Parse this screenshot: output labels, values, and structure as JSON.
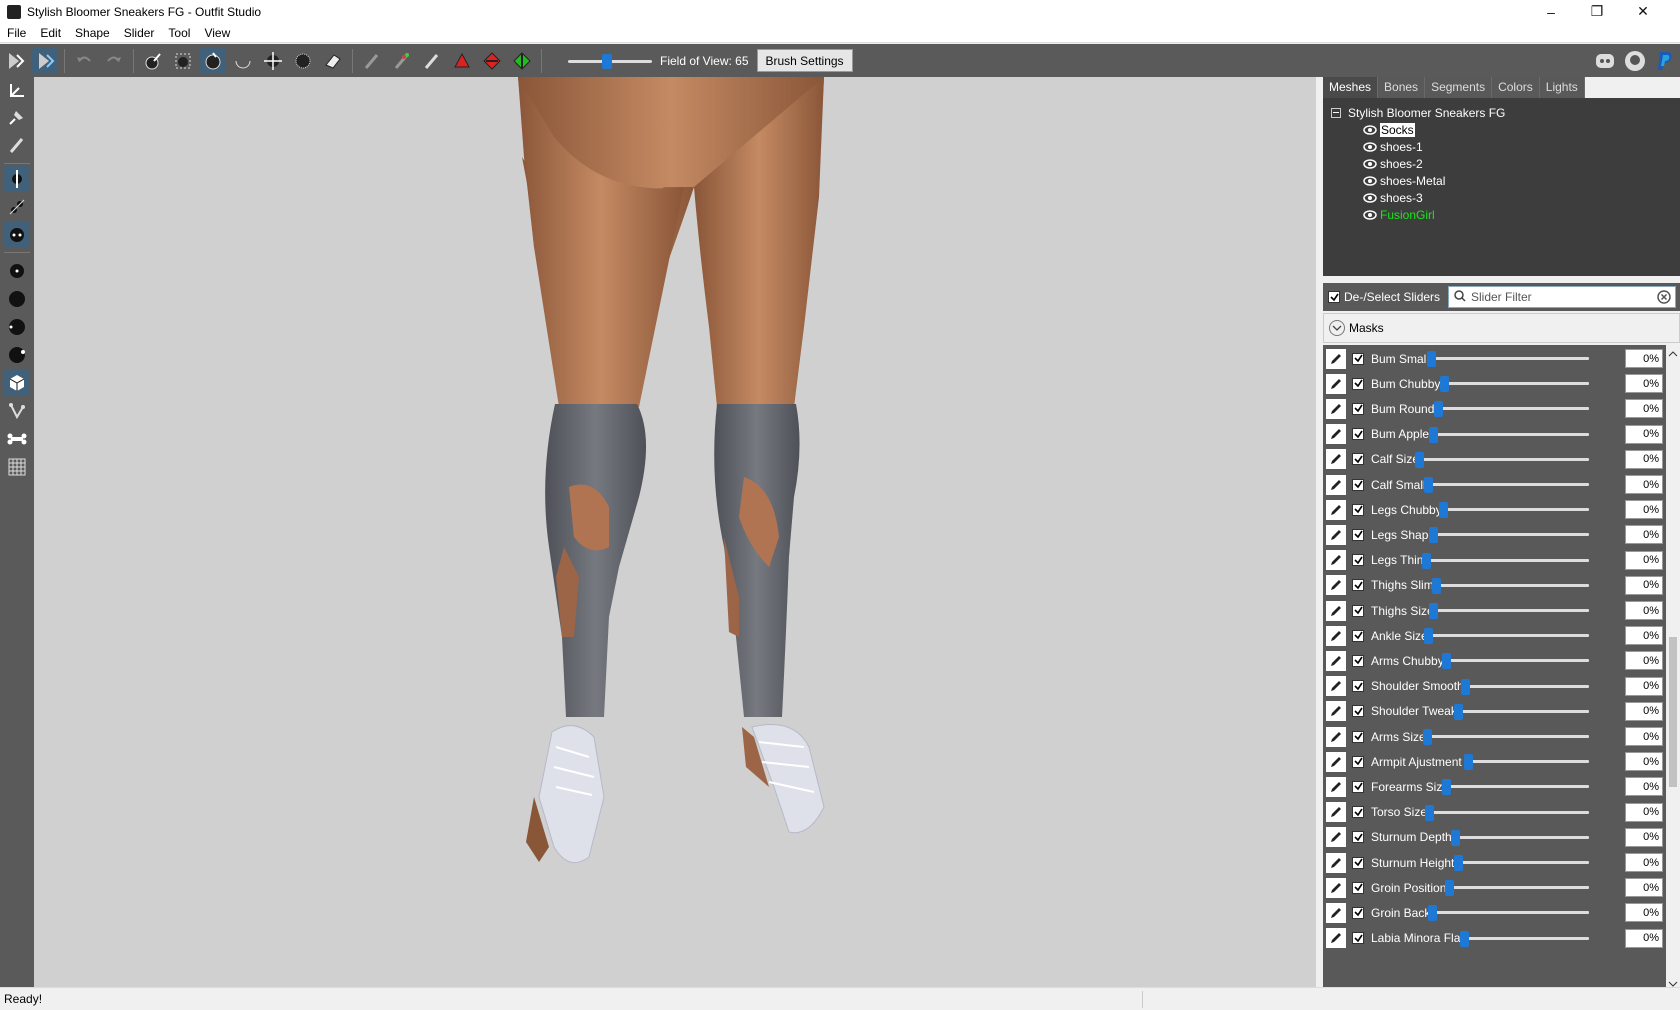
{
  "window": {
    "title": "Stylish Bloomer Sneakers FG - Outfit Studio"
  },
  "menu": [
    "File",
    "Edit",
    "Shape",
    "Slider",
    "Tool",
    "View"
  ],
  "toolbar": {
    "fov_label": "Field of View: 65",
    "fov_value": 65,
    "brush_settings_label": "Brush Settings",
    "left_icons": [
      "outfit-studio-icon",
      "slider-edit-icon",
      "undo-icon",
      "redo-icon",
      "select-icon",
      "mask-select-icon",
      "inflate-brush-icon",
      "deflate-brush-icon",
      "move-brush-icon",
      "smooth-brush-icon",
      "eraser-icon",
      "weight-brush-icon",
      "color-brush-icon",
      "alpha-brush-icon",
      "vertex-brush-icon",
      "collapse-vertex-icon",
      "flip-edge-icon"
    ],
    "right_icons": [
      "discord-icon",
      "github-icon",
      "paypal-icon"
    ]
  },
  "left_tools": [
    "transform-icon",
    "pivot-icon",
    "vertex-edit-icon",
    "mirror-x-icon",
    "mirror-y-icon",
    "mirror-z-icon",
    "brush-size-1-icon",
    "brush-size-2-icon",
    "brush-size-3-icon",
    "brush-size-4-icon",
    "connected-only-icon",
    "bone-edit-icon",
    "bone-icon",
    "grid-icon"
  ],
  "panel": {
    "tabs": [
      "Meshes",
      "Bones",
      "Segments",
      "Colors",
      "Lights"
    ],
    "active_tab": "Meshes",
    "project": "Stylish Bloomer Sneakers FG",
    "meshes": [
      {
        "name": "Socks",
        "selected": true,
        "color": "#ffffff"
      },
      {
        "name": "shoes-1",
        "selected": false,
        "color": "#ffffff"
      },
      {
        "name": "shoes-2",
        "selected": false,
        "color": "#ffffff"
      },
      {
        "name": "shoes-Metal",
        "selected": false,
        "color": "#ffffff"
      },
      {
        "name": "shoes-3",
        "selected": false,
        "color": "#ffffff"
      },
      {
        "name": "FusionGirl",
        "selected": false,
        "color": "#19e619"
      }
    ],
    "deselect_label": "De-/Select Sliders",
    "filter_placeholder": "Slider Filter",
    "masks_label": "Masks"
  },
  "sliders": [
    {
      "name": "Bum Small",
      "value": "0%",
      "checked": true
    },
    {
      "name": "Bum Chubby",
      "value": "0%",
      "checked": true
    },
    {
      "name": "Bum Round",
      "value": "0%",
      "checked": true
    },
    {
      "name": "Bum Apple",
      "value": "0%",
      "checked": true
    },
    {
      "name": "Calf Size",
      "value": "0%",
      "checked": true
    },
    {
      "name": "Calf Small",
      "value": "0%",
      "checked": true
    },
    {
      "name": "Legs Chubby",
      "value": "0%",
      "checked": true
    },
    {
      "name": "Legs Shape",
      "value": "0%",
      "checked": true
    },
    {
      "name": "Legs Thin",
      "value": "0%",
      "checked": true
    },
    {
      "name": "Thighs Slim",
      "value": "0%",
      "checked": true
    },
    {
      "name": "Thighs Size",
      "value": "0%",
      "checked": true
    },
    {
      "name": "Ankle Size",
      "value": "0%",
      "checked": true
    },
    {
      "name": "Arms Chubby",
      "value": "0%",
      "checked": true
    },
    {
      "name": "Shoulder Smooth",
      "value": "0%",
      "checked": true
    },
    {
      "name": "Shoulder Tweak",
      "value": "0%",
      "checked": true
    },
    {
      "name": "Arms Size",
      "value": "0%",
      "checked": true
    },
    {
      "name": "Armpit Ajustment",
      "value": "0%",
      "checked": true
    },
    {
      "name": "Forearms Size",
      "value": "0%",
      "checked": true
    },
    {
      "name": "Torso Size",
      "value": "0%",
      "checked": true
    },
    {
      "name": "Sturnum Depth",
      "value": "0%",
      "checked": true
    },
    {
      "name": "Sturnum Height",
      "value": "0%",
      "checked": true
    },
    {
      "name": "Groin Position",
      "value": "0%",
      "checked": true
    },
    {
      "name": "Groin Back",
      "value": "0%",
      "checked": true
    },
    {
      "name": "Labia Minora Flat",
      "value": "0%",
      "checked": true
    }
  ],
  "status": {
    "text": "Ready!"
  },
  "colors": {
    "toolbar": "#5a5a5a",
    "accent": "#1e78d6",
    "viewport": "#d0d0d0",
    "highlight_mesh": "#19e619"
  }
}
